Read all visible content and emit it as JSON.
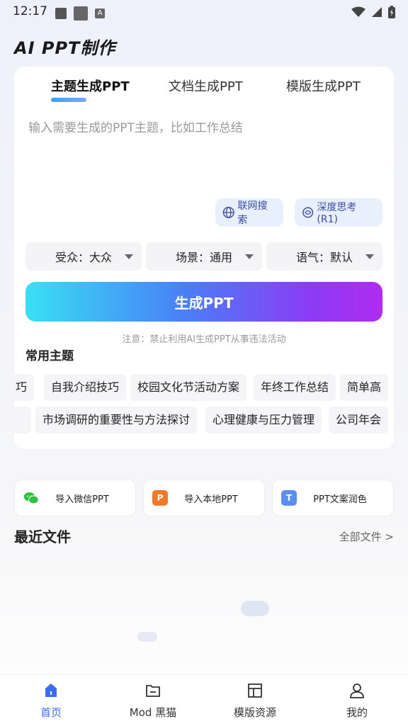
{
  "status_bar": {
    "time": "12:17",
    "a_icon": "A"
  },
  "app_title": "AI PPT制作",
  "tabs": [
    {
      "label": "主题生成PPT",
      "active": true
    },
    {
      "label": "文档生成PPT",
      "active": false
    },
    {
      "label": "模版生成PPT",
      "active": false
    }
  ],
  "prompt_placeholder": "输入需要生成的PPT主题，比如工作总结",
  "chips": {
    "web_search": "联网搜索",
    "deep_think": "深度思考(R1)"
  },
  "selects": [
    {
      "label": "受众：大众"
    },
    {
      "label": "场景：通用"
    },
    {
      "label": "语气：默认"
    }
  ],
  "generate_button": "生成PPT",
  "notice": "注意：禁止利用AI生成PPT从事违法活动",
  "common_topics_title": "常用主题",
  "topics_row1": [
    "巧",
    "自我介绍技巧",
    "校园文化节活动方案",
    "年终工作总结",
    "简单高"
  ],
  "topics_row2": [
    "",
    "市场调研的重要性与方法探讨",
    "心理健康与压力管理",
    "公司年会"
  ],
  "actions": [
    {
      "label": "导入微信PPT",
      "icon": "wechat-icon"
    },
    {
      "label": "导入本地PPT",
      "icon": "ppt-file-icon"
    },
    {
      "label": "PPT文案润色",
      "icon": "text-t-icon"
    }
  ],
  "recent": {
    "title": "最近文件",
    "all": "全部文件 >"
  },
  "bottom_nav": [
    {
      "label": "首页",
      "active": true
    },
    {
      "label": "Mod 黑猫",
      "active": false
    },
    {
      "label": "模版资源",
      "active": false
    },
    {
      "label": "我的",
      "active": false
    }
  ],
  "colors": {
    "accent": "#3b6cf6",
    "chip_bg": "#e8effd",
    "gradient_start": "#38e0f3",
    "gradient_end": "#b02cf0"
  }
}
